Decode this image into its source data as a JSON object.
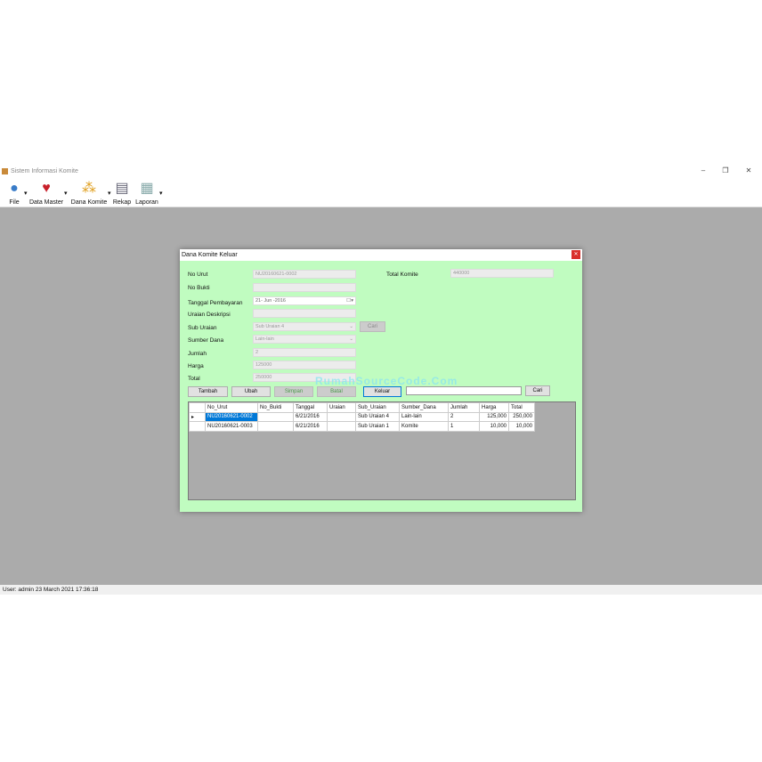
{
  "app": {
    "title": "Sistem Informasi Komite",
    "toolbar": [
      {
        "label": "File",
        "icon": "user-icon"
      },
      {
        "label": "Data Master",
        "icon": "heart-plus-icon"
      },
      {
        "label": "Dana Komite",
        "icon": "org-chart-icon"
      },
      {
        "label": "Rekap",
        "icon": "report-icon"
      },
      {
        "label": "Laporan",
        "icon": "document-icon"
      }
    ],
    "status": "User: admin  23 March 2021 17:36:18"
  },
  "dialog": {
    "title": "Dana Komite Keluar",
    "fields": {
      "no_urut": {
        "label": "No Urut",
        "value": "NU20160621-0002"
      },
      "no_bukti": {
        "label": "No Bukti",
        "value": ""
      },
      "tanggal": {
        "label": "Tanggal Pembayaran",
        "value": "21- Jun -2016"
      },
      "uraian": {
        "label": "Uraian Deskripsi",
        "value": ""
      },
      "sub_uraian": {
        "label": "Sub Uraian",
        "value": "Sub Uraian 4"
      },
      "sumber_dana": {
        "label": "Sumber Dana",
        "value": "Lain-lain"
      },
      "jumlah": {
        "label": "Jumlah",
        "value": "2"
      },
      "harga": {
        "label": "Harga",
        "value": "125000"
      },
      "total": {
        "label": "Total",
        "value": "250000"
      },
      "total_komite": {
        "label": "Total Komite",
        "value": "440000"
      }
    },
    "buttons": {
      "cari_sub": "Cari",
      "tambah": "Tambah",
      "ubah": "Ubah",
      "simpan": "Simpan",
      "batal": "Batal",
      "keluar": "Keluar",
      "cari": "Cari"
    },
    "search_value": "",
    "watermark": "RumahSourceCode.Com",
    "grid": {
      "columns": [
        "No_Urut",
        "No_Bukti",
        "Tanggal",
        "Uraian",
        "Sub_Uraian",
        "Sumber_Dana",
        "Jumlah",
        "Harga",
        "Total"
      ],
      "rows": [
        [
          "NU20160621-0002",
          "",
          "6/21/2016",
          "",
          "Sub Uraian 4",
          "Lain-lain",
          "2",
          "125,000",
          "250,000"
        ],
        [
          "NU20160621-0003",
          "",
          "6/21/2016",
          "",
          "Sub Uraian 1",
          "Komite",
          "1",
          "10,000",
          "10,000"
        ]
      ]
    }
  }
}
